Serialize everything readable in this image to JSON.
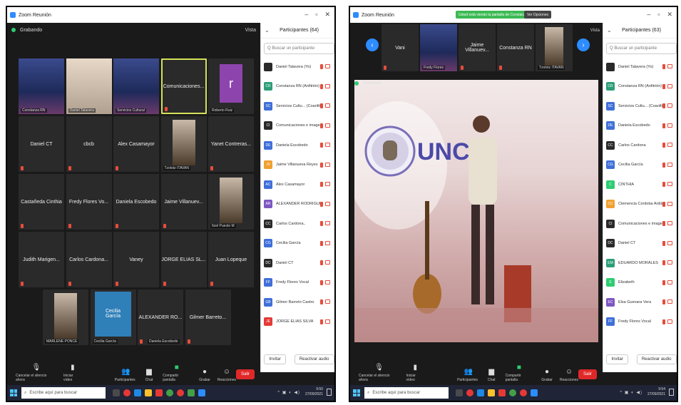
{
  "left": {
    "window_title": "Zoom Reunión",
    "recording": "Grabando",
    "view_label": "Vista",
    "tiles": [
      {
        "label": "Constanza RN",
        "kind": "banner"
      },
      {
        "label": "Daniel Talavera",
        "kind": "office"
      },
      {
        "label": "Servicios Cultural",
        "kind": "banner"
      },
      {
        "label": "Comunicaciones...",
        "kind": "text",
        "active": true
      },
      {
        "label": "Roberto Ruiz",
        "kind": "avatar",
        "letter": "r"
      },
      {
        "label": "Daniel CT",
        "kind": "text"
      },
      {
        "label": "cbcb",
        "kind": "text"
      },
      {
        "label": "Alex Casamayor",
        "kind": "text"
      },
      {
        "label": "Tzolotz ITAVAN",
        "kind": "person"
      },
      {
        "label": "Yanet Contreras...",
        "kind": "text"
      },
      {
        "label": "Castañeda Cinthia",
        "kind": "text"
      },
      {
        "label": "Fredy Flores Vo...",
        "kind": "text"
      },
      {
        "label": "Daniela Escobedo",
        "kind": "text"
      },
      {
        "label": "Jaime Villanuev...",
        "kind": "text"
      },
      {
        "label": "Itzel Puesto M",
        "kind": "person"
      },
      {
        "label": "Judith Marigen...",
        "kind": "text"
      },
      {
        "label": "Carlos Cardona...",
        "kind": "text"
      },
      {
        "label": "Vaney",
        "kind": "text"
      },
      {
        "label": "JORGE ELIAS SL...",
        "kind": "text"
      },
      {
        "label": "Juan Lopeque",
        "kind": "text"
      }
    ],
    "row5": [
      {
        "label": "MARLENE PONCE",
        "kind": "person"
      },
      {
        "label": "Cecilia García",
        "kind": "blue",
        "inner": "Cecilia\nGarcía"
      },
      {
        "label": "ALEXANDER RO...",
        "kind": "text",
        "sub": "Daniela Escobedo"
      },
      {
        "label": "Gilmer Barreto...",
        "kind": "text"
      }
    ],
    "panel": {
      "title": "Participantes (64)",
      "search_placeholder": "Q Buscar un participante",
      "participants": [
        {
          "initials": "",
          "color": "#2a2a2a",
          "name": "Daniel Talavera (Yo)"
        },
        {
          "initials": "CR",
          "color": "#2d9d78",
          "name": "Constanza RN (Anfitrión)"
        },
        {
          "initials": "SC",
          "color": "#3f6fd8",
          "name": "Servicios Cultu... (Coanfitrión)"
        },
        {
          "initials": "CI",
          "color": "#2a2a2a",
          "name": "Comunicaciones e imagen instit..."
        },
        {
          "initials": "DE",
          "color": "#3f6fd8",
          "name": "Daniela Escobedo"
        },
        {
          "initials": "JV",
          "color": "#f0a030",
          "name": "Jaime Villanueva Reyes"
        },
        {
          "initials": "AC",
          "color": "#3f6fd8",
          "name": "Alex Casamayor"
        },
        {
          "initials": "AR",
          "color": "#7e57c2",
          "name": "ALEXANDER RODRIGUEZ SAUCEDO"
        },
        {
          "initials": "CC",
          "color": "#2a2a2a",
          "name": "Carlos Cardona.."
        },
        {
          "initials": "CG",
          "color": "#3f6fd8",
          "name": "Cecilia García"
        },
        {
          "initials": "DC",
          "color": "#2a2a2a",
          "name": "Daniel CT"
        },
        {
          "initials": "FF",
          "color": "#3f6fd8",
          "name": "Fredy Flores Vocal"
        },
        {
          "initials": "GB",
          "color": "#3f6fd8",
          "name": "Gilmer Barreto Castro"
        },
        {
          "initials": "JE",
          "color": "#e53935",
          "name": "JORGE ELIAS SILVA"
        }
      ],
      "invite": "Invitar",
      "mute_all": "Reactivar audio"
    },
    "toolbar": {
      "audio": "Cancelar el silencio ahora",
      "video": "Iniciar vídeo",
      "participants": "Participantes",
      "participants_count": "64",
      "chat": "Chat",
      "share": "Compartir pantalla",
      "record": "Grabar",
      "reactions": "Reacciones",
      "end": "Salir"
    },
    "taskbar": {
      "search": "Escribe aquí para buscar",
      "time": "9:50",
      "date": "27/09/2021"
    }
  },
  "right": {
    "window_title": "Zoom Reunión",
    "share_banner": "Usted está viendo la pantalla de Constanza RN",
    "view_options": "Ver Opciones",
    "view_label": "Vista",
    "recording": "Grabando",
    "strip": [
      {
        "label": "Vani",
        "kind": "text"
      },
      {
        "label": "Fredy Flores",
        "kind": "banner"
      },
      {
        "label": "Jaime Villanuev...",
        "kind": "text"
      },
      {
        "label": "Constanza RN",
        "kind": "text"
      },
      {
        "label": "Tzolotz ITAVAN",
        "kind": "person"
      }
    ],
    "main_logo_text": "UNCA",
    "panel": {
      "title": "Participantes (63)",
      "search_placeholder": "Q Buscar un participante",
      "participants": [
        {
          "initials": "",
          "color": "#2a2a2a",
          "name": "Daniel Talavera (Yo)"
        },
        {
          "initials": "CR",
          "color": "#2d9d78",
          "name": "Constanza RN (Anfitrión)"
        },
        {
          "initials": "SC",
          "color": "#3f6fd8",
          "name": "Servicios Cultu... (Coanfitrión)"
        },
        {
          "initials": "DE",
          "color": "#3f6fd8",
          "name": "Daniela Escobedo"
        },
        {
          "initials": "CC",
          "color": "#2a2a2a",
          "name": "Carlos Cardona"
        },
        {
          "initials": "CG",
          "color": "#3f6fd8",
          "name": "Cecilia García"
        },
        {
          "initials": "C",
          "color": "#2ecc71",
          "name": "CINTHIA"
        },
        {
          "initials": "CC",
          "color": "#f0a030",
          "name": "Clemencia Cordoba Ardila"
        },
        {
          "initials": "CI",
          "color": "#2a2a2a",
          "name": "Comunicaciones e imagen instit..."
        },
        {
          "initials": "DC",
          "color": "#2a2a2a",
          "name": "Daniel CT"
        },
        {
          "initials": "EM",
          "color": "#2d9d78",
          "name": "EDUARDO MORALES"
        },
        {
          "initials": "E",
          "color": "#2ecc71",
          "name": "Elizabeth"
        },
        {
          "initials": "EC",
          "color": "#7e57c2",
          "name": "Elsa Guevara Vera"
        },
        {
          "initials": "FF",
          "color": "#3f6fd8",
          "name": "Fredy Flores Vocal"
        }
      ],
      "invite": "Invitar",
      "mute_all": "Reactivar audio"
    },
    "toolbar": {
      "audio": "Cancelar el silencio ahora",
      "video": "Iniciar vídeo",
      "participants": "Participantes",
      "participants_count": "63",
      "chat": "Chat",
      "share": "Compartir pantalla",
      "record": "Grabar",
      "reactions": "Reacciones",
      "end": "Salir"
    },
    "taskbar": {
      "search": "Escribe aquí para buscar",
      "time": "9:54",
      "date": "27/09/2021"
    }
  }
}
